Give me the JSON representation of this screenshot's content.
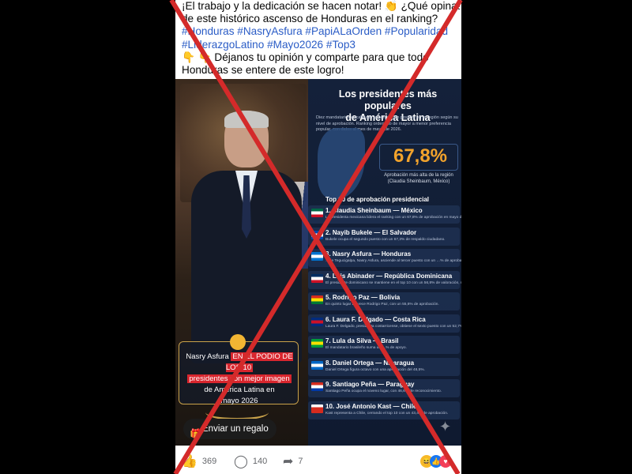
{
  "caption": {
    "line1": "¡El trabajo y la dedicación se hacen notar! 👏 ¿Qué opinas",
    "line2": "de este histórico ascenso de Honduras en el ranking?",
    "hashtags1": "#Honduras #NasryAsfura #PapiALaOrden #Popularidad",
    "hashtags2": "#LiderazgoLatino #Mayo2026 #Top3",
    "line3": "👇 👇 Déjanos tu opinión y comparte para que todo",
    "line4": "Honduras se entere de este logro!"
  },
  "infographic": {
    "title_line1": "Los presidentes más populares",
    "title_line2": "de América Latina",
    "description": "Diez mandatarios encabezan la percepción positiva en la región según su nivel de aprobación. Ranking ordenado de mayor a menor preferencia popular, con datos al mes de mayo de 2026.",
    "highlight_pct": "67,8%",
    "highlight_label": "Aprobación más alta de la región (Claudia Sheinbaum, México)",
    "top10_title": "Top 10 de aprobación presidencial",
    "ranking": [
      {
        "name": "1. Claudia Sheinbaum — México",
        "sub": "La presidenta mexicana lidera el ranking con un 67,8% de aprobación en mayo de 2026.",
        "flag": [
          "#006847",
          "#ffffff",
          "#ce1126"
        ]
      },
      {
        "name": "2. Nayib Bukele — El Salvador",
        "sub": "Bukele ocupa el segundo puesto con un 67,3% de respaldo ciudadano.",
        "flag": [
          "#0047ab",
          "#ffffff",
          "#0047ab"
        ]
      },
      {
        "name": "3. Nasry Asfura — Honduras",
        "sub": "…de Tegucigalpa, Nasry Asfura, asciende al tercer puesto con un …% de aprobación, destacando su imagen positiva.",
        "flag": [
          "#0073cf",
          "#ffffff",
          "#0073cf"
        ]
      },
      {
        "name": "4. Luis Abinader — República Dominicana",
        "sub": "El presidente dominicano se mantiene en el top 10 con un 56,8% de valoración, reflejando su gestión actual.",
        "flag": [
          "#002d62",
          "#ffffff",
          "#ce1126"
        ]
      },
      {
        "name": "5. Rodrigo Paz — Bolivia",
        "sub": "En quinto lugar aparece Rodrigo Paz, con un 55,6% de aprobación.",
        "flag": [
          "#d52b1e",
          "#f9e300",
          "#007934"
        ]
      },
      {
        "name": "6. Laura F. Delgado — Costa Rica",
        "sub": "Laura F. Delgado, presidenta costarricense, obtiene el sexto puesto con un 52,7%",
        "flag": [
          "#002b7f",
          "#ce1126",
          "#002b7f"
        ]
      },
      {
        "name": "7. Lula da Silva — Brasil",
        "sub": "El mandatario brasileño suma un …% de apoyo.",
        "flag": [
          "#009c3b",
          "#ffdf00",
          "#009c3b"
        ]
      },
      {
        "name": "8. Daniel Ortega — Nicaragua",
        "sub": "Daniel Ortega figura octavo con una aprobación del 48,5%.",
        "flag": [
          "#0067c6",
          "#ffffff",
          "#0067c6"
        ]
      },
      {
        "name": "9. Santiago Peña — Paraguay",
        "sub": "Santiago Peña ocupa el noveno lugar, con 46,6% de reconocimiento.",
        "flag": [
          "#d52b1e",
          "#ffffff",
          "#0038a8"
        ]
      },
      {
        "name": "10. José Antonio Kast — Chile",
        "sub": "Kast representa a Chile, cerrando el top 10 con un 43,4% de aprobación.",
        "flag": [
          "#ffffff",
          "#d52b1e",
          "#d52b1e"
        ]
      }
    ],
    "badge": {
      "name": "Nasry Asfura",
      "red1": "EN EL PODIO DE LOS 10",
      "red2": "presidentes con mejor imagen",
      "tail1": "de América Latina en",
      "tail2": "mayo 2026"
    }
  },
  "gift_button": "Enviar un regalo",
  "actions": {
    "likes": "369",
    "comments": "140",
    "shares": "7"
  },
  "colors": {
    "x_mark": "#d42a2a",
    "hashtag": "#2a5cc6",
    "accent_pct": "#f2a32c"
  }
}
